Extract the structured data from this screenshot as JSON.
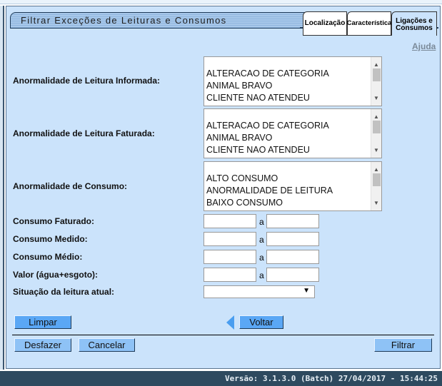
{
  "header": {
    "title": "Filtrar Exceções de Leituras e Consumos",
    "help": "Ajuda"
  },
  "tabs": [
    {
      "label": "Localização"
    },
    {
      "label": "Característica"
    },
    {
      "label": "Ligações e Consumos",
      "selected": true
    }
  ],
  "fields": {
    "anorm_informada": {
      "label": "Anormalidade de Leitura Informada:",
      "options": [
        "ALTERACAO DE CATEGORIA",
        "ANIMAL BRAVO",
        "CLIENTE NAO ATENDEU"
      ]
    },
    "anorm_faturada": {
      "label": "Anormalidade de Leitura Faturada:",
      "options": [
        "ALTERACAO DE CATEGORIA",
        "ANIMAL BRAVO",
        "CLIENTE NAO ATENDEU"
      ]
    },
    "anorm_consumo": {
      "label": "Anormalidade de Consumo:",
      "options": [
        "ALTO CONSUMO",
        "ANORMALIDADE DE LEITURA",
        "BAIXO CONSUMO"
      ]
    },
    "ranges": [
      {
        "label": "Consumo Faturado:",
        "from": "",
        "to": ""
      },
      {
        "label": "Consumo Medido:",
        "from": "",
        "to": ""
      },
      {
        "label": "Consumo Médio:",
        "from": "",
        "to": ""
      },
      {
        "label": "Valor (água+esgoto):",
        "from": "",
        "to": ""
      }
    ],
    "range_sep": "a",
    "situacao": {
      "label": "Situação da leitura atual:",
      "value": ""
    }
  },
  "buttons": {
    "limpar": "Limpar",
    "voltar": "Voltar",
    "desfazer": "Desfazer",
    "cancelar": "Cancelar",
    "filtrar": "Filtrar"
  },
  "footer": {
    "version": "Versão: 3.1.3.0 (Batch) 27/04/2017 - 15:44:25"
  },
  "colors": {
    "panel": "#cbe3fb",
    "button": "#5aa7f5",
    "footer": "#2e4a5f"
  }
}
